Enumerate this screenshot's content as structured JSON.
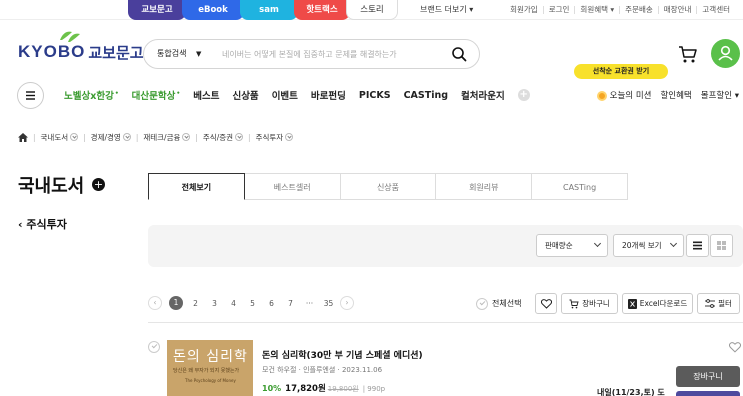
{
  "service_tabs": [
    "교보문고",
    "eBook",
    "sam",
    "핫트랙스",
    "스토리"
  ],
  "brand_more": "브랜드 더보기 ▾",
  "util_links": [
    "회원가입",
    "로그인",
    "회원혜택 ▾",
    "주문배송",
    "매장안내",
    "고객센터"
  ],
  "logo": {
    "en": "KYOBO",
    "kr": "교보문고"
  },
  "search": {
    "scope": "통합검색",
    "placeholder": "네이버는 어떻게 본질에 집중하고 문제를 해결하는가"
  },
  "promo_badge": "선착순 교환권 받기",
  "gnb": {
    "items": [
      "노벨상x한강",
      "대산문학상",
      "베스트",
      "신상품",
      "이벤트",
      "바로펀딩",
      "PICKS",
      "CASTing",
      "컬처라운지"
    ],
    "plus": "+",
    "right": [
      "오늘의 미션",
      "할인혜택",
      "몰프할인 ▾"
    ]
  },
  "breadcrumb": [
    "국내도서",
    "경제/경영",
    "재테크/금융",
    "주식/증권",
    "주식투자"
  ],
  "side": {
    "title": "국내도서",
    "plus": "+",
    "category": "‹ 주식투자"
  },
  "tabs": [
    "전체보기",
    "베스트셀러",
    "신상품",
    "회원리뷰",
    "CASTing"
  ],
  "filters": {
    "sort": "판매량순",
    "per_page": "20개씩 보기"
  },
  "pager": {
    "pages": [
      "1",
      "2",
      "3",
      "4",
      "5",
      "6",
      "7",
      "···",
      "35"
    ],
    "prev": "‹",
    "next": "›"
  },
  "list_actions": {
    "select_all": "전체선택",
    "cart": "장바구니",
    "excel": "Excel다운로드",
    "filter": "필터"
  },
  "product": {
    "cover_title": "돈의 심리학",
    "cover_sub": "당신은 왜 부자가 되지 못했는가",
    "cover_eng": "The Psychology of Money",
    "title": "돈의 심리학(30만 부 기념 스페셜 에디션)",
    "meta": "모건 하우절 · 인플루엔셜 · 2023.11.06",
    "discount": "10%",
    "sale_price": "17,820원",
    "orig_price": "19,800원",
    "points": "| 990p",
    "delivery": "내일(11/23,토) 도",
    "cart_btn": "장바구니"
  }
}
